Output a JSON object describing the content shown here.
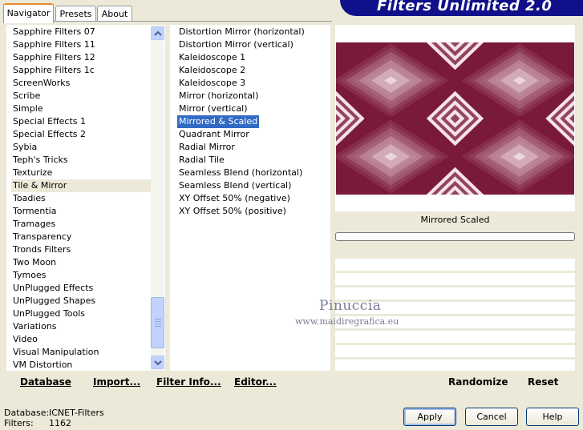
{
  "title": "Filters Unlimited 2.0",
  "tabs": [
    {
      "label": "Navigator"
    },
    {
      "label": "Presets"
    },
    {
      "label": "About"
    }
  ],
  "categories": [
    "Sapphire Filters 07",
    "Sapphire Filters 11",
    "Sapphire Filters 12",
    "Sapphire Filters 1c",
    "ScreenWorks",
    "Scribe",
    "Simple",
    "Special Effects 1",
    "Special Effects 2",
    "Sybia",
    "Teph's Tricks",
    "Texturize",
    "Tile & Mirror",
    "Toadies",
    "Tormentia",
    "Tramages",
    "Transparency",
    "Tronds Filters",
    "Two Moon",
    "Tymoes",
    "UnPlugged Effects",
    "UnPlugged Shapes",
    "UnPlugged Tools",
    "Variations",
    "Video",
    "Visual Manipulation",
    "VM Distortion"
  ],
  "selected_category": "Tile & Mirror",
  "filters": [
    "Distortion Mirror (horizontal)",
    "Distortion Mirror (vertical)",
    "Kaleidoscope 1",
    "Kaleidoscope 2",
    "Kaleidoscope 3",
    "Mirror (horizontal)",
    "Mirror (vertical)",
    "Mirrored & Scaled",
    "Quadrant Mirror",
    "Radial Mirror",
    "Radial Tile",
    "Seamless Blend (horizontal)",
    "Seamless Blend (vertical)",
    "XY Offset 50% (negative)",
    "XY Offset 50% (positive)"
  ],
  "selected_filter": "Mirrored & Scaled",
  "preview_name": "Mirrored  Scaled",
  "progress": 0,
  "watermark": {
    "line1": "Pinuccia",
    "line2": "www.maidiregrafica.eu"
  },
  "panel_buttons": {
    "database": "Database",
    "import": "Import...",
    "filter_info": "Filter Info...",
    "editor": "Editor...",
    "randomize": "Randomize",
    "reset": "Reset"
  },
  "footer": {
    "database_label": "Database:",
    "database_value": "ICNET-Filters",
    "filters_label": "Filters:",
    "filters_value": "1162"
  },
  "dialog_buttons": {
    "apply": "Apply",
    "cancel": "Cancel",
    "help": "Help"
  },
  "colors": {
    "selection": "#316ac5",
    "title_bar": "#10108a",
    "preview_dark": "#7a1a3a",
    "preview_light": "#fbeef2"
  }
}
